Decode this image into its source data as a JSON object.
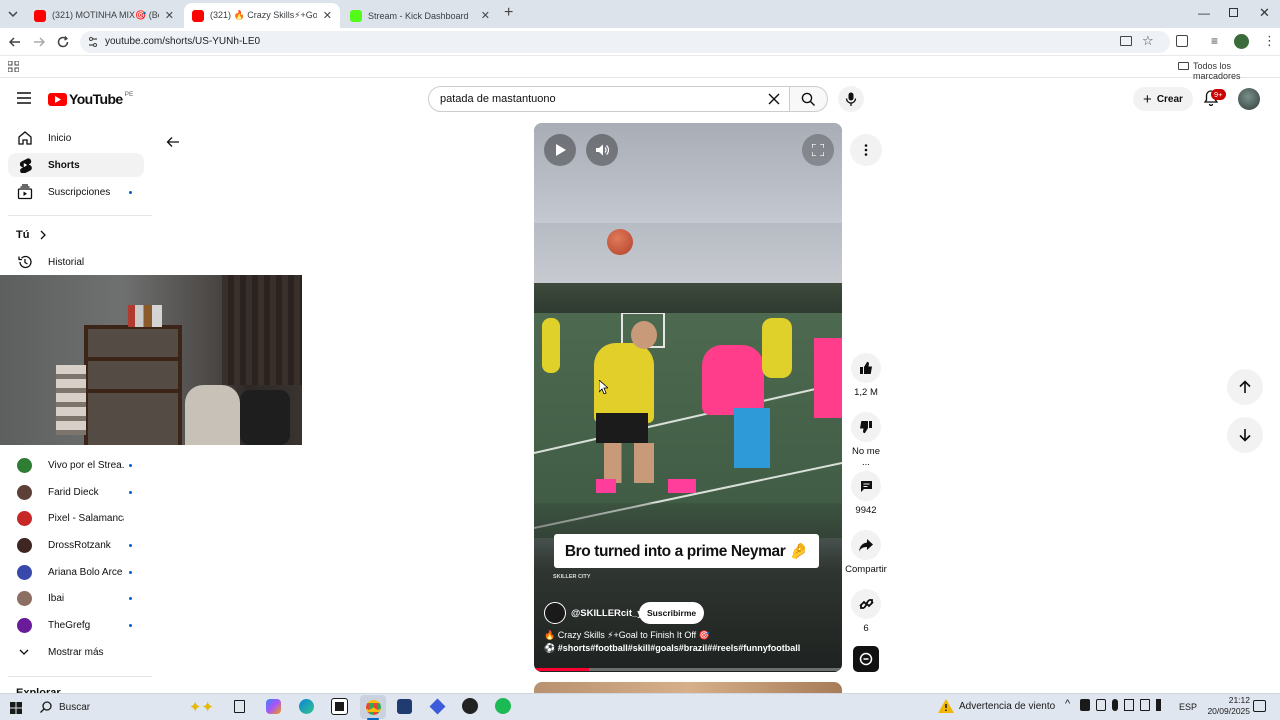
{
  "browser": {
    "tabs": [
      {
        "title": "(321) MOTINHA MIX🎯 (Beele...",
        "color": "#ff0000"
      },
      {
        "title": "(321) 🔥 Crazy Skills⚡+Goal to...",
        "color": "#ff0000"
      },
      {
        "title": "Stream - Kick Dashboard",
        "color": "#53fc18"
      }
    ],
    "new_tab": "+",
    "url": "youtube.com/shorts/US-YUNh-LE0",
    "bookmarks_label": "Todos los marcadores"
  },
  "youtube": {
    "logo_text": "YouTube",
    "region": "PE",
    "search_value": "patada de mastantuono",
    "create_label": "Crear",
    "notif_count": "9+"
  },
  "sidebar": {
    "items": [
      {
        "label": "Inicio"
      },
      {
        "label": "Shorts"
      },
      {
        "label": "Suscripciones"
      }
    ],
    "you_label": "Tú",
    "history_label": "Historial",
    "subs": [
      {
        "name": "Vivo por el Strea...",
        "color": "#2e7d32"
      },
      {
        "name": "Farid Dieck",
        "color": "#5d4037"
      },
      {
        "name": "Pixel - Salamanca",
        "color": "#c62828"
      },
      {
        "name": "DrossRotzank",
        "color": "#3e2723"
      },
      {
        "name": "Ariana Bolo Arce",
        "color": "#3949ab"
      },
      {
        "name": "Ibai",
        "color": "#8d6e63"
      },
      {
        "name": "TheGrefg",
        "color": "#6a1b9a"
      }
    ],
    "show_more": "Mostrar más",
    "explore": "Explorar"
  },
  "short": {
    "caption": "Bro turned into a prime Neymar 🤌",
    "watermark": "SKILLER CITY",
    "channel": "@SKILLERcit_y",
    "subscribe": "Suscribirme",
    "title": "🔥 Crazy Skills ⚡+Goal to Finish It Off 🎯",
    "tags": "⚽ #shorts#football#skill#goals#brazil##reels#funnyfootball",
    "progress": 0.18
  },
  "actions": {
    "likes": "1,2 M",
    "dislike": "No me ...",
    "comments": "9942",
    "share": "Compartir",
    "remix": "6"
  },
  "taskbar": {
    "search": "Buscar",
    "weather": "Advertencia de viento",
    "lang": "ESP",
    "time": "21:12",
    "date": "20/09/2025"
  }
}
